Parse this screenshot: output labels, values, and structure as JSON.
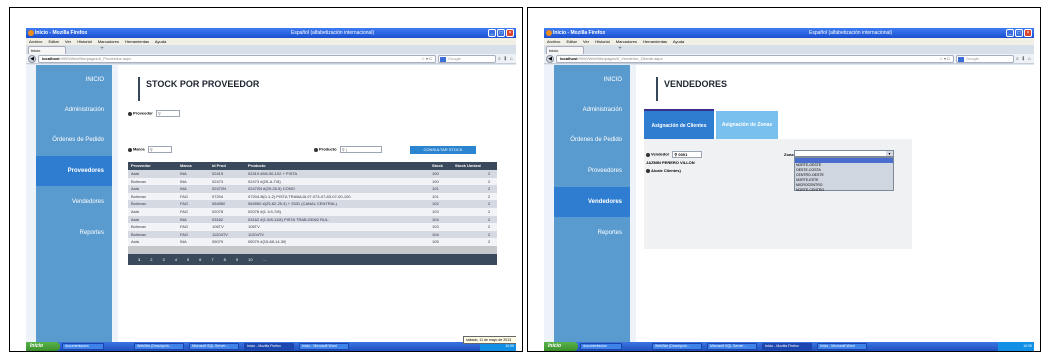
{
  "browser": {
    "title": "Inicio - Mozilla Firefox",
    "language": "Español (alfabetización internacional)",
    "menu": [
      "Archivo",
      "Editar",
      "Ver",
      "Historial",
      "Marcadores",
      "Herramientas",
      "Ayuda"
    ],
    "tab_label": "Inicio",
    "search_placeholder": "Google"
  },
  "left": {
    "url_host": "localhost",
    "url_path": ":9999/WebSite/pages/II_Proveedor.aspx",
    "sidebar": [
      "INICIO",
      "Administración",
      "Órdenes de Pedido",
      "Proveedores",
      "Vendedores",
      "Reportes"
    ],
    "active_item": "Proveedores",
    "title": "STOCK POR PROVEEDOR",
    "filters": {
      "proveedor_label": "Proveedor",
      "marca_label": "Marca",
      "producto_label": "Producto",
      "consult_button": "CONSULTAR STOCK"
    },
    "columns": [
      "Proveedor",
      "Marca",
      "Id Prod",
      "Producto",
      "Stock",
      "Stock Umbral"
    ],
    "rows": [
      [
        "Asisi",
        "INA",
        "02419",
        "02419 #D8-90-102 + PISTA",
        "100",
        "2"
      ],
      [
        "Bohman",
        "INA",
        "02473",
        "02473 #(25-A-T/8)",
        "100",
        "2"
      ],
      [
        "Asisi",
        "INA",
        "02472N",
        "02472N #(29-25.5) CONO",
        "101",
        "2"
      ],
      [
        "Bohman",
        "FAG",
        "07204",
        "07204-B(0-1-2) PISTA TRABAJA 07.073-07-83-07-00-100",
        "101",
        "2"
      ],
      [
        "Bohman",
        "FAG",
        "064550",
        "064550 #(25-62-25.4) + 3331 (CANAL CENTRAL)",
        "102",
        "2"
      ],
      [
        "Asisi",
        "FAG",
        "02078",
        "02078 #(1 1/4-7/8)",
        "103",
        "2"
      ],
      [
        "Asisi",
        "INA",
        "03162",
        "03162 #(1.5/8-11/8) PISTA TRAB.03062 RUL.",
        "104",
        "2"
      ],
      [
        "Bohman",
        "FAG",
        "106TV",
        "106TV",
        "103",
        "2"
      ],
      [
        "Bohman",
        "FAG",
        "11204TV",
        "11204TV",
        "104",
        "2"
      ],
      [
        "Asisi",
        "INA",
        "05079",
        "05079 #(15.88-14.30)",
        "105",
        "2"
      ]
    ],
    "pager": [
      "1",
      "2",
      "3",
      "4",
      "5",
      "6",
      "7",
      "8",
      "9",
      "10",
      "..."
    ],
    "date_tooltip": "sábado, 11 de mayo de 2013"
  },
  "right": {
    "url_host": "localhost",
    "url_path": ":9999/WebSite/pages/II_Vendedor_Cliente.aspx",
    "sidebar": [
      "INICIO",
      "Administración",
      "Órdenes de Pedido",
      "Proveedores",
      "Vendedores",
      "Reportes"
    ],
    "active_item": "Vendedores",
    "title": "VENDEDORES",
    "tab_clientes": "Asignación de Clientes",
    "tab_zonas": "Asignación de Zonas",
    "vendedor_label": "Vendedor",
    "vendedor_value": "0001",
    "vendedor_name": "JAZMIN PERERO VILLON",
    "alcance_label": "Alcale Clientes)",
    "zona_label": "Zona",
    "zona_options": [
      "NORTE-OESTE",
      "OESTE-COSTA",
      "CENTRO-OESTE",
      "NORTE-ESTE",
      "MICROCENTRO",
      "NORTE-CENTRO"
    ]
  },
  "taskbar": {
    "start": "Inicio",
    "tasks_left": [
      "documentacion",
      "WebSite (Descripció...",
      "Microsoft SQL Server ...",
      "Inicio - Mozilla Firefox",
      "Inicio - Microsoft Word"
    ],
    "tasks_right": [
      "documentacion",
      "WebSite (Descripció...",
      "Microsoft SQL Server ...",
      "Inicio - Mozilla Firefox",
      "Inicio - Microsoft Word"
    ],
    "clock": "10:09"
  },
  "colors": {
    "sidebar": "#5a9bcf",
    "sidebar_active": "#2e7dd0",
    "table_header": "#3a495c",
    "accent_button": "#2a84cf"
  }
}
